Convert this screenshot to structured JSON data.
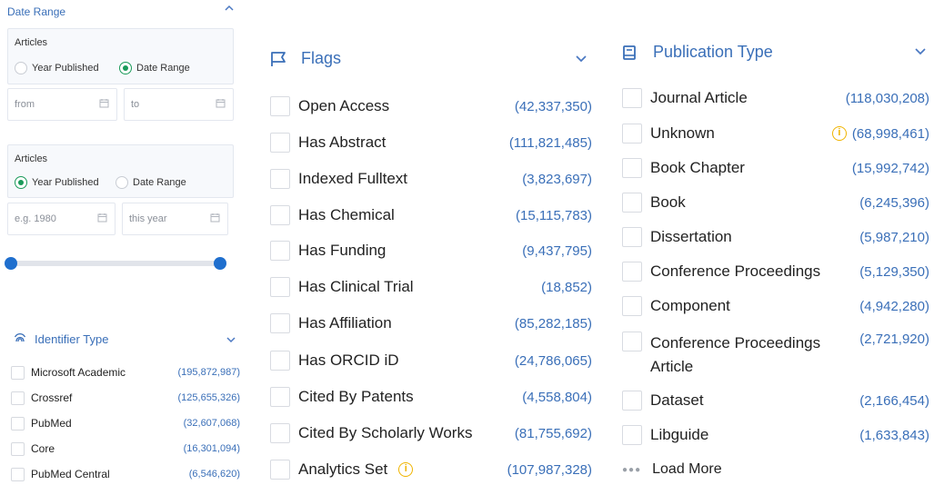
{
  "date_range": {
    "title": "Date Range",
    "panel1": {
      "label": "Articles",
      "option_year": "Year Published",
      "option_range": "Date Range",
      "from_placeholder": "from",
      "to_placeholder": "to"
    },
    "panel2": {
      "label": "Articles",
      "option_year": "Year Published",
      "option_range": "Date Range",
      "from_placeholder": "e.g. 1980",
      "to_placeholder": "this year"
    }
  },
  "identifier_type": {
    "title": "Identifier Type",
    "items": [
      {
        "label": "Microsoft Academic",
        "count": "(195,872,987)"
      },
      {
        "label": "Crossref",
        "count": "(125,655,326)"
      },
      {
        "label": "PubMed",
        "count": "(32,607,068)"
      },
      {
        "label": "Core",
        "count": "(16,301,094)"
      },
      {
        "label": "PubMed Central",
        "count": "(6,546,620)"
      }
    ]
  },
  "flags": {
    "title": "Flags",
    "items": [
      {
        "label": "Open Access",
        "count": "(42,337,350)"
      },
      {
        "label": "Has Abstract",
        "count": "(111,821,485)"
      },
      {
        "label": "Indexed Fulltext",
        "count": "(3,823,697)"
      },
      {
        "label": "Has Chemical",
        "count": "(15,115,783)"
      },
      {
        "label": "Has Funding",
        "count": "(9,437,795)"
      },
      {
        "label": "Has Clinical Trial",
        "count": "(18,852)"
      },
      {
        "label": "Has Affiliation",
        "count": "(85,282,185)"
      },
      {
        "label": "Has ORCID iD",
        "count": "(24,786,065)"
      },
      {
        "label": "Cited By Patents",
        "count": "(4,558,804)"
      },
      {
        "label": "Cited By Scholarly Works",
        "count": "(81,755,692)"
      },
      {
        "label": "Analytics Set",
        "count": "(107,987,328)"
      }
    ]
  },
  "publication_type": {
    "title": "Publication Type",
    "items": [
      {
        "label": "Journal Article",
        "count": "(118,030,208)"
      },
      {
        "label": "Unknown",
        "count": "(68,998,461)"
      },
      {
        "label": "Book Chapter",
        "count": "(15,992,742)"
      },
      {
        "label": "Book",
        "count": "(6,245,396)"
      },
      {
        "label": "Dissertation",
        "count": "(5,987,210)"
      },
      {
        "label": "Conference Proceedings",
        "count": "(5,129,350)"
      },
      {
        "label": "Component",
        "count": "(4,942,280)"
      },
      {
        "label": "Conference Proceedings Article",
        "count": "(2,721,920)"
      },
      {
        "label": "Dataset",
        "count": "(2,166,454)"
      },
      {
        "label": "Libguide",
        "count": "(1,633,843)"
      }
    ],
    "load_more": "Load More"
  },
  "icons": {
    "info": "info-icon",
    "flag": "flag-icon",
    "book": "book-icon",
    "fingerprint": "fingerprint-icon",
    "calendar": "calendar-icon"
  },
  "colors": {
    "accent": "#3a6fb8",
    "radio_selected": "#1a9a5a",
    "slider": "#1f6fce",
    "info": "#f0b400"
  }
}
